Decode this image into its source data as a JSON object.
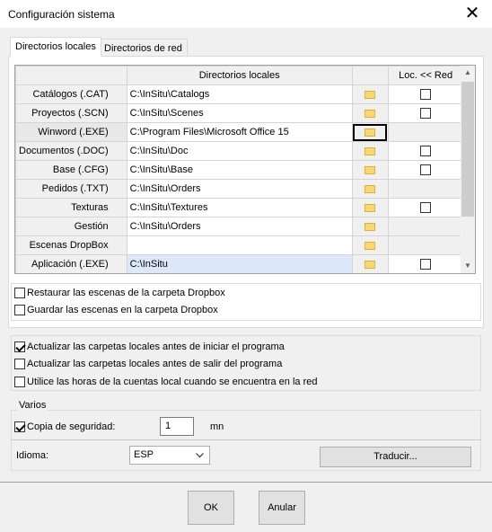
{
  "window": {
    "title": "Configuración sistema",
    "close_glyph": "✕"
  },
  "tabs": [
    {
      "label": "Directorios locales",
      "active": true
    },
    {
      "label": "Directorios de red",
      "active": false
    }
  ],
  "grid": {
    "columns": {
      "name": "",
      "path": "Directorios locales",
      "browse": "",
      "loc": "Loc. << Red"
    },
    "rows": [
      {
        "name": "Catálogos (.CAT)",
        "path": "C:\\InSitu\\Catalogs",
        "has_checkbox": true,
        "checked": false
      },
      {
        "name": "Proyectos (.SCN)",
        "path": "C:\\InSitu\\Scenes",
        "has_checkbox": true,
        "checked": false
      },
      {
        "name": "Winword (.EXE)",
        "path": "C:\\Program Files\\Microsoft Office 15",
        "has_checkbox": false,
        "checked": false
      },
      {
        "name": "Documentos (.DOC)",
        "path": "C:\\InSitu\\Doc",
        "has_checkbox": true,
        "checked": false
      },
      {
        "name": "Base (.CFG)",
        "path": "C:\\InSitu\\Base",
        "has_checkbox": true,
        "checked": false
      },
      {
        "name": "Pedidos (.TXT)",
        "path": "C:\\InSitu\\Orders",
        "has_checkbox": false,
        "checked": false
      },
      {
        "name": "Texturas",
        "path": "C:\\InSitu\\Textures",
        "has_checkbox": true,
        "checked": false
      },
      {
        "name": "Gestión",
        "path": "C:\\InSitu\\Orders",
        "has_checkbox": false,
        "checked": false
      },
      {
        "name": "Escenas DropBox",
        "path": "",
        "has_checkbox": false,
        "checked": false
      },
      {
        "name": "Aplicación (.EXE)",
        "path": "C:\\InSitu",
        "has_checkbox": true,
        "checked": false
      }
    ],
    "scroll_up": "▲",
    "scroll_down": "▼"
  },
  "dropbox": {
    "restore_label": "Restaurar las escenas de la carpeta Dropbox",
    "restore_checked": false,
    "save_label": "Guardar las escenas en la carpeta Dropbox",
    "save_checked": false
  },
  "update": {
    "before_start_label": "Actualizar las carpetas locales antes de iniciar el programa",
    "before_start_checked": true,
    "before_exit_label": "Actualizar las carpetas locales antes de salir del programa",
    "before_exit_checked": false,
    "local_hours_label": "Utilice las horas de la cuentas local cuando se encuentra en la red",
    "local_hours_checked": false
  },
  "varios": {
    "group_label": "Varios",
    "backup_label": "Copia de seguridad:",
    "backup_checked": true,
    "backup_value": "1",
    "backup_unit": "mn"
  },
  "language": {
    "label": "Idioma:",
    "selected": "ESP",
    "translate_button": "Traducir..."
  },
  "buttons": {
    "ok": "OK",
    "cancel": "Anular"
  }
}
